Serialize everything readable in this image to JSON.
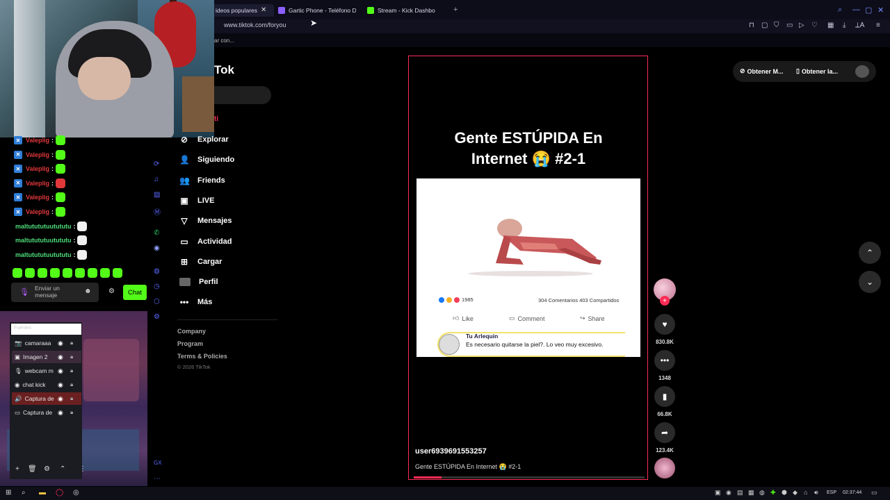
{
  "browser": {
    "tabs": [
      {
        "label": "ideos populares",
        "favicon_color": "#ff3355"
      },
      {
        "label": "Gartic Phone - Teléfono D",
        "favicon_color": "#8c60ff"
      },
      {
        "label": "Stream - Kick Dashbo",
        "favicon_color": "#53fc18"
      }
    ],
    "url": "www.tiktok.com/foryou",
    "bookmark_text": "ar con..."
  },
  "chat": {
    "messages": [
      {
        "user": "Valeplig",
        "color": "#e0383b",
        "emote_color": "#53fc18"
      },
      {
        "user": "Valeplig",
        "color": "#e0383b",
        "emote_color": "#53fc18"
      },
      {
        "user": "Valeplig",
        "color": "#e0383b",
        "emote_color": "#53fc18"
      },
      {
        "user": "Valeplig",
        "color": "#e0383b",
        "emote_color": "#e0383b"
      },
      {
        "user": "Valeplig",
        "color": "#e0383b",
        "emote_color": "#53fc18"
      },
      {
        "user": "Valeplig",
        "color": "#e0383b",
        "emote_color": "#53fc18"
      },
      {
        "user": "maltutututuutututu",
        "color": "#4fdc7a",
        "emote_color": "#f0f0f0"
      },
      {
        "user": "maltutututuutututu",
        "color": "#4fdc7a",
        "emote_color": "#f0f0f0"
      },
      {
        "user": "maltutututuutututu",
        "color": "#4fdc7a",
        "emote_color": "#f0f0f0"
      }
    ],
    "input_placeholder": "Enviar un mensaje",
    "send_label": "Chat"
  },
  "obs": {
    "filter_placeholder": "Fuentes",
    "sources": [
      {
        "label": "camaraaa",
        "icon": "📷"
      },
      {
        "label": "Imagen 2",
        "icon": "▣"
      },
      {
        "label": "webcam m",
        "icon": "🎙"
      },
      {
        "label": "chat kick",
        "icon": "◉"
      },
      {
        "label": "Captura de",
        "icon": "🔊"
      },
      {
        "label": "Captura de",
        "icon": "▭"
      }
    ]
  },
  "tiktok": {
    "logo": "Tok",
    "foryou_fragment": "ti",
    "nav": [
      {
        "label": "Explorar",
        "icon": "⊘"
      },
      {
        "label": "Siguiendo",
        "icon": "👤"
      },
      {
        "label": "Friends",
        "icon": "👥"
      },
      {
        "label": "LIVE",
        "icon": "▣"
      },
      {
        "label": "Mensajes",
        "icon": "▽"
      },
      {
        "label": "Actividad",
        "icon": "▭"
      },
      {
        "label": "Cargar",
        "icon": "⊞"
      },
      {
        "label": "Perfil",
        "icon": ""
      },
      {
        "label": "Más",
        "icon": "•••"
      }
    ],
    "footer": [
      "Company",
      "Program",
      "Terms & Policies"
    ],
    "copyright": "© 2026 TikTok",
    "top_buttons": [
      "Obtener M...",
      "Obtener la..."
    ]
  },
  "video": {
    "title_line1": "Gente ESTÚPIDA En",
    "title_line2": "Internet 😭 #2-1",
    "username": "user6939691553257",
    "caption": "Gente ESTÚPIDA En Internet 😭 #2-1",
    "progress": 0.12,
    "fb_post": {
      "reactions_count": "1985",
      "counts": "304 Comentarios 403 Compartidos",
      "actions": [
        "Like",
        "Comment",
        "Share"
      ],
      "commenter": "Tu Arlequin",
      "comment": "Es necesario quitarse la piel?. Lo veo muy excesivo."
    },
    "stats": {
      "likes": "830.8K",
      "comments": "1348",
      "saves": "66.8K",
      "shares": "123.4K"
    }
  },
  "taskbar": {
    "lang": "ESP",
    "time": "02:37:44"
  },
  "colors": {
    "tiktok_red": "#fe2c55",
    "kick_green": "#53fc18"
  }
}
